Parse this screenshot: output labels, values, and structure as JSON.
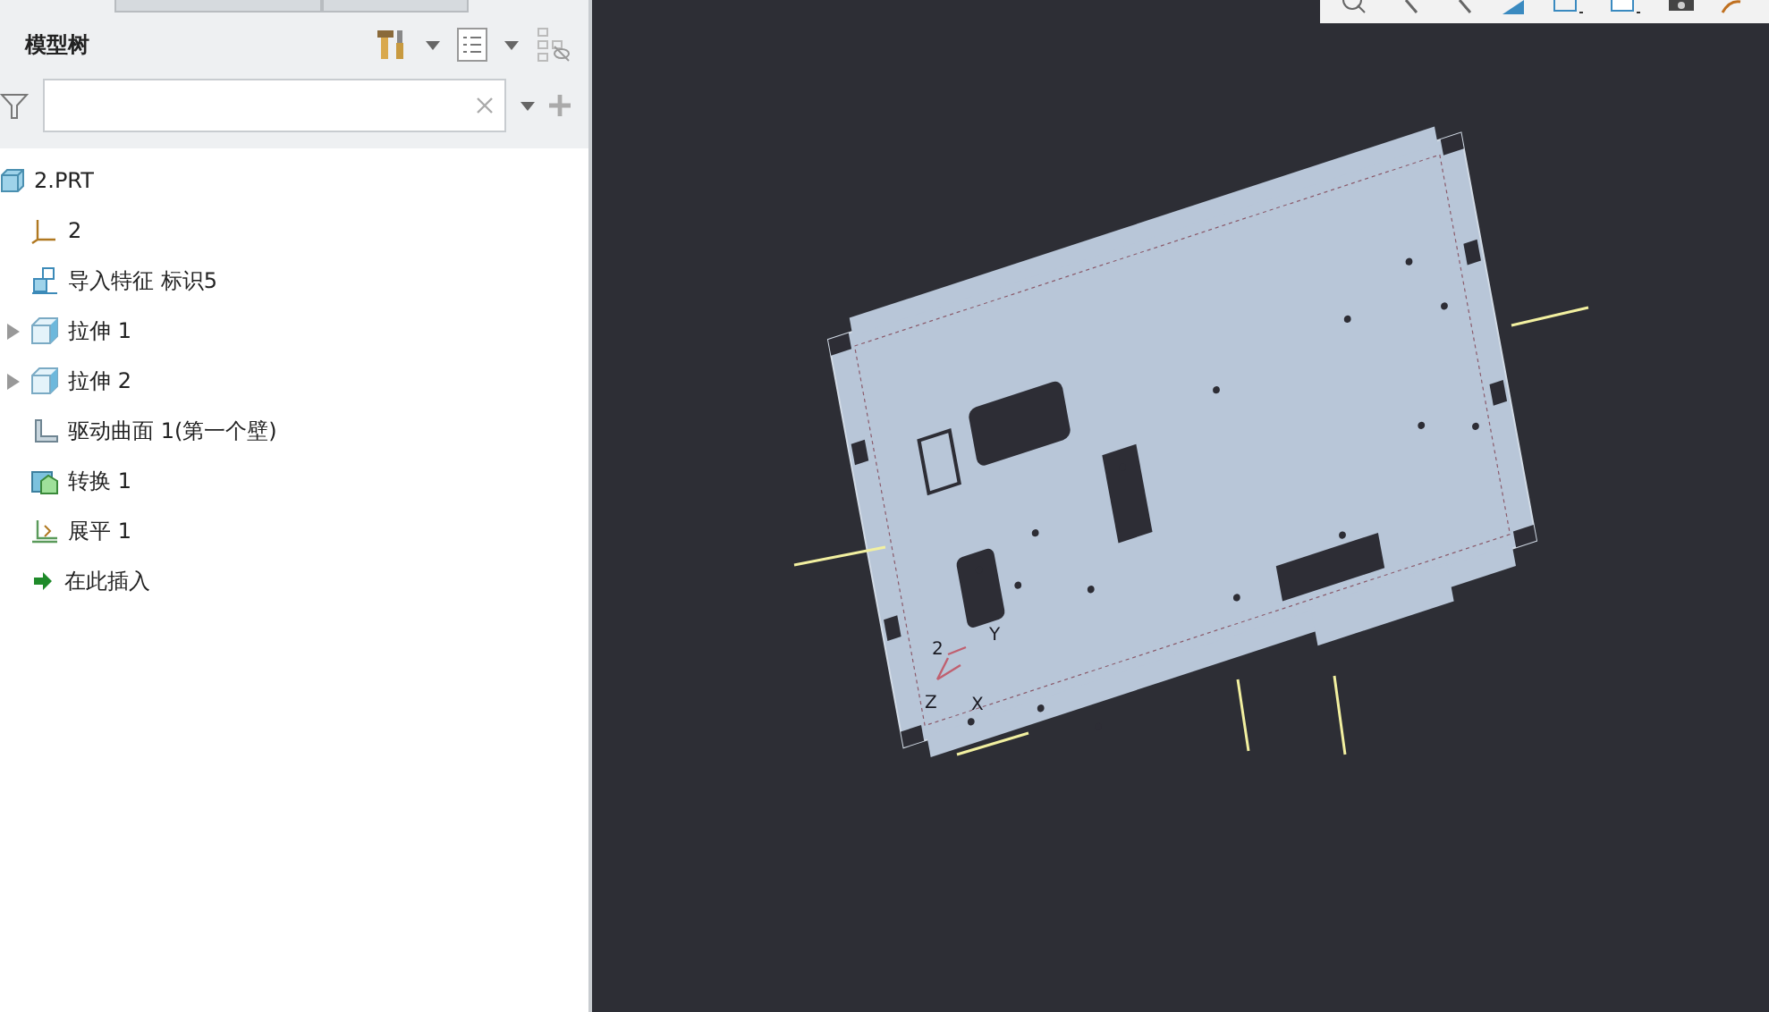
{
  "panel": {
    "title": "模型树"
  },
  "tree": {
    "label": "2.PRT",
    "kind": "part",
    "children": [
      {
        "label": "2",
        "kind": "csys",
        "expandable": false
      },
      {
        "label": "导入特征 标识5",
        "kind": "import",
        "expandable": false
      },
      {
        "label": "拉伸 1",
        "kind": "extrude",
        "expandable": true
      },
      {
        "label": "拉伸 2",
        "kind": "extrude",
        "expandable": true
      },
      {
        "label": "驱动曲面 1(第一个壁)",
        "kind": "surface",
        "expandable": false
      },
      {
        "label": "转换 1",
        "kind": "convert",
        "expandable": false
      },
      {
        "label": "展平 1",
        "kind": "flatten",
        "expandable": false
      },
      {
        "label": "在此插入",
        "kind": "insert",
        "expandable": false
      }
    ]
  },
  "viewport": {
    "csys_labels": [
      "2",
      "Y",
      "Z",
      "X"
    ]
  }
}
